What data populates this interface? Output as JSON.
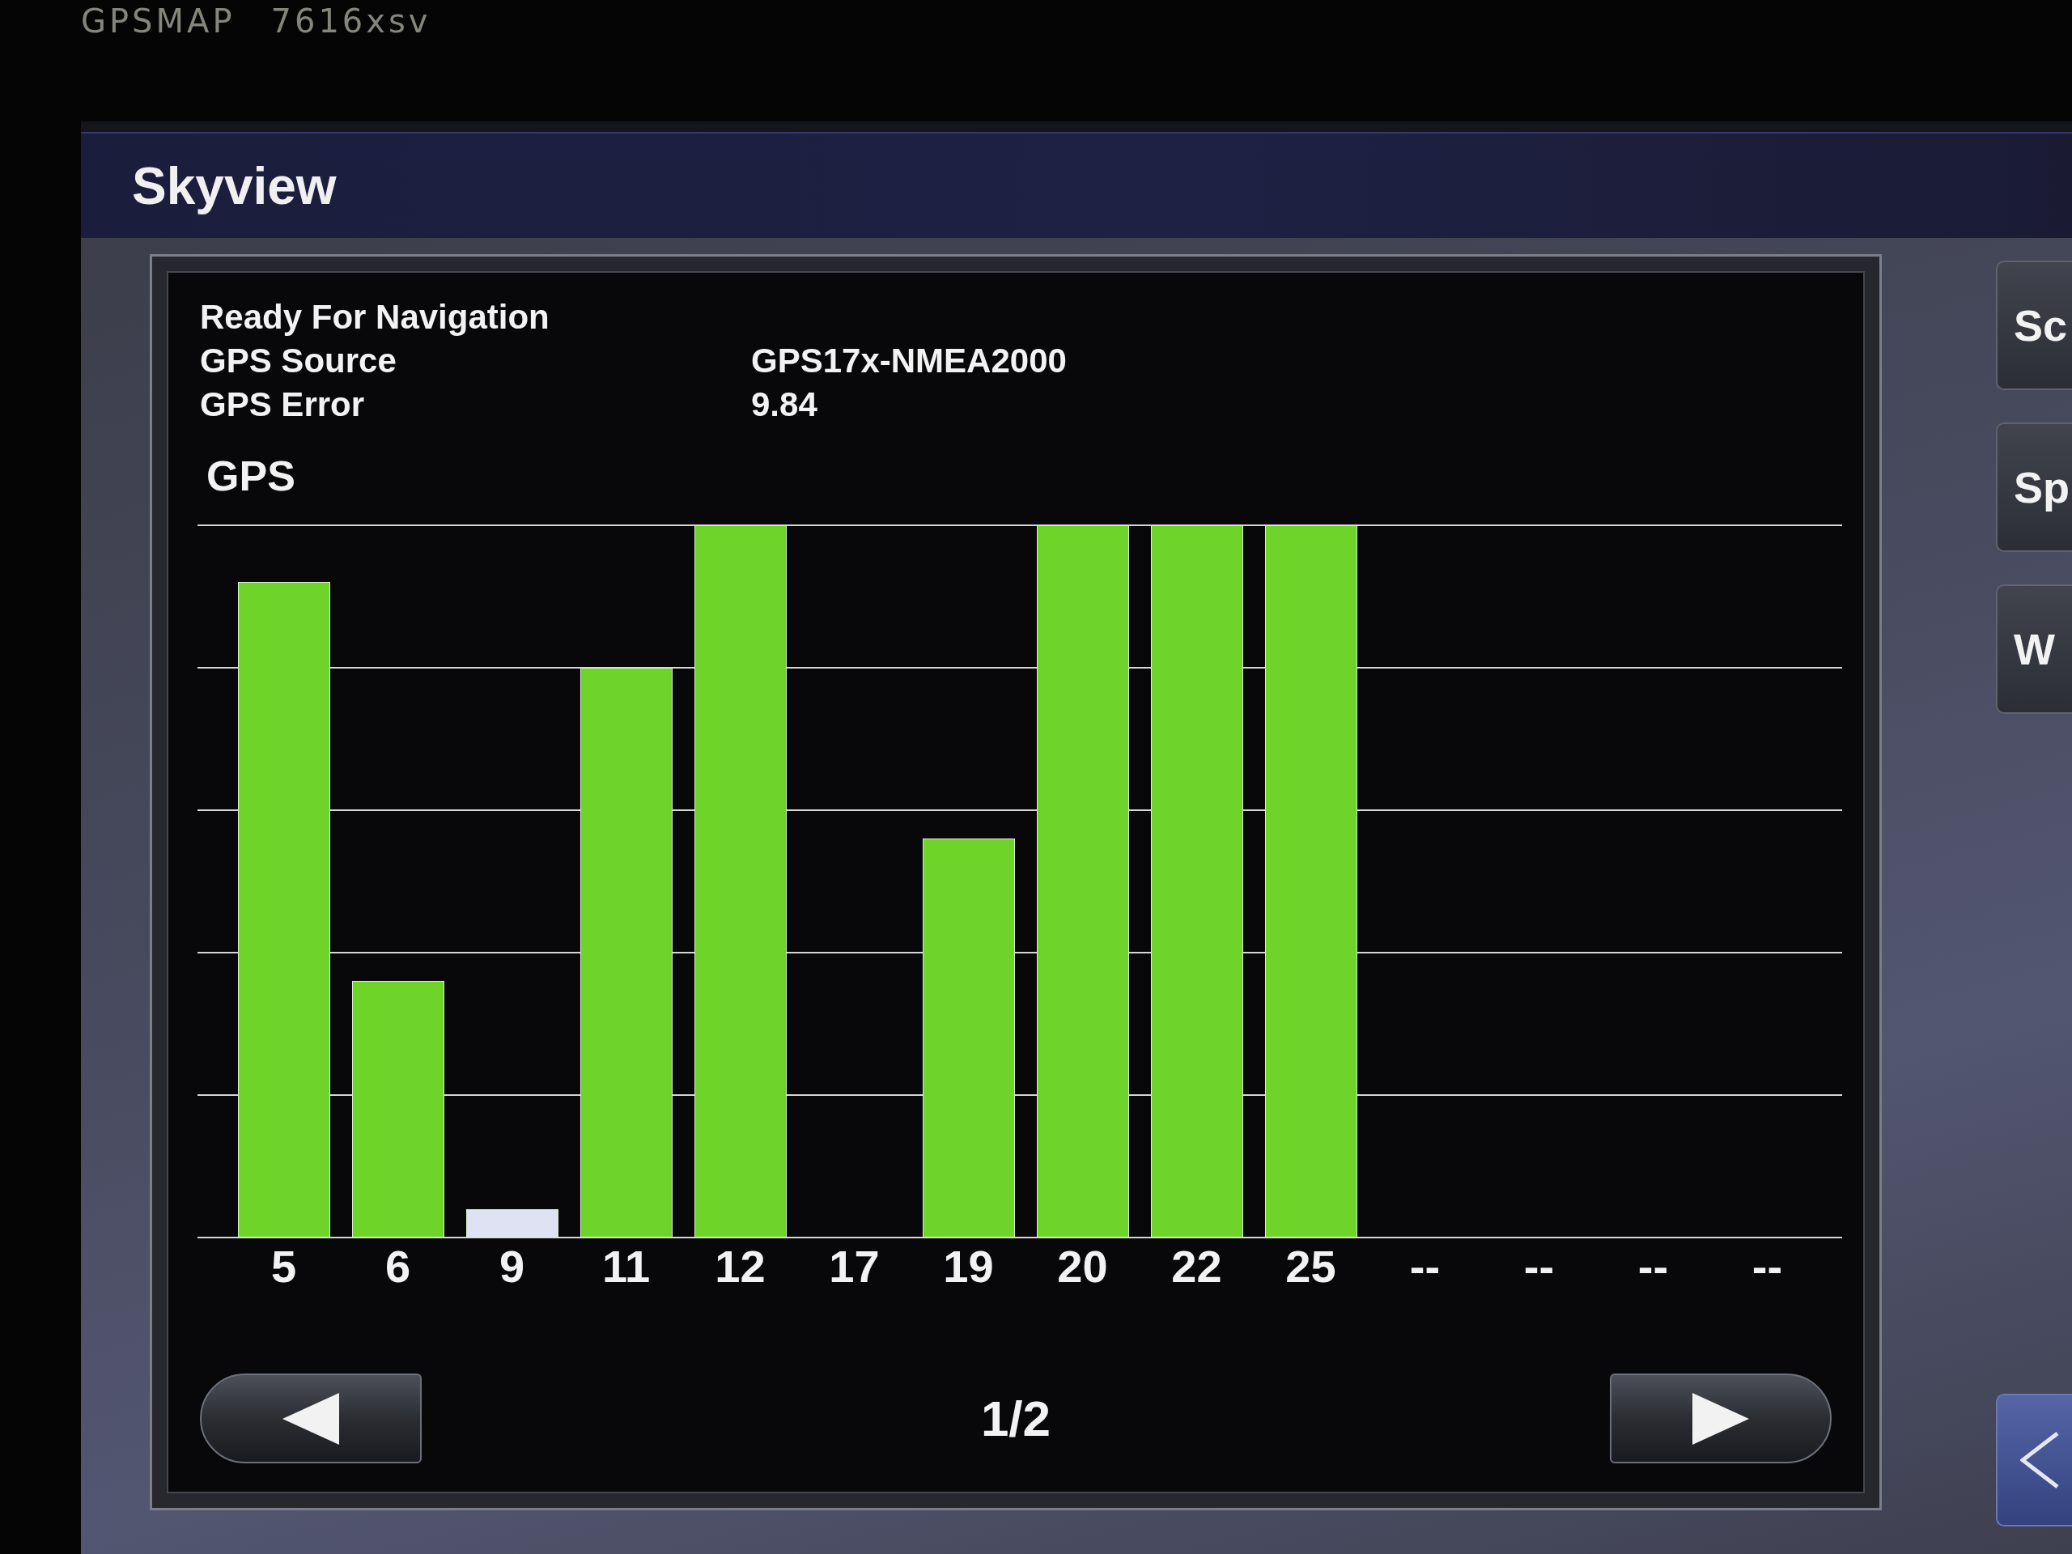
{
  "bezel": {
    "brand": "GPSMAP",
    "model": "7616xsv"
  },
  "window": {
    "title": "Skyview"
  },
  "status": {
    "message": "Ready For Navigation",
    "fields": [
      {
        "label": "GPS Source",
        "value": "GPS17x-NMEA2000"
      },
      {
        "label": "GPS Error",
        "value": "9.84"
      }
    ]
  },
  "constellation": {
    "title": "GPS",
    "satellites": [
      {
        "label": "5",
        "level": 0.92,
        "color": "#6fd42a"
      },
      {
        "label": "6",
        "level": 0.36,
        "color": "#6fd42a"
      },
      {
        "label": "9",
        "level": 0.04,
        "color": "#dfe2f2"
      },
      {
        "label": "11",
        "level": 0.8,
        "color": "#6fd42a"
      },
      {
        "label": "12",
        "level": 1.0,
        "color": "#6fd42a"
      },
      {
        "label": "17"
      },
      {
        "label": "19",
        "level": 0.56,
        "color": "#6fd42a"
      },
      {
        "label": "20",
        "level": 1.0,
        "color": "#6fd42a"
      },
      {
        "label": "22",
        "level": 1.0,
        "color": "#6fd42a"
      },
      {
        "label": "25",
        "level": 1.0,
        "color": "#6fd42a"
      },
      {
        "label": "--"
      },
      {
        "label": "--"
      },
      {
        "label": "--"
      },
      {
        "label": "--"
      }
    ]
  },
  "pager": {
    "page": "1/2"
  },
  "side_buttons": [
    {
      "label": "Sc"
    },
    {
      "label": "Sp"
    },
    {
      "label": "W"
    }
  ]
}
